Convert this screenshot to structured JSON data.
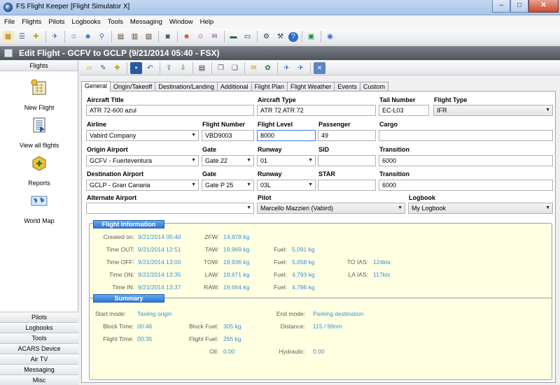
{
  "window": {
    "title": "FS Flight Keeper [Flight Simulator X]",
    "minimize": "–",
    "maximize": "□",
    "close": "✕"
  },
  "menu": [
    "File",
    "Flights",
    "Pilots",
    "Logbooks",
    "Tools",
    "Messaging",
    "Window",
    "Help"
  ],
  "header": {
    "title": "Edit Flight - GCFV to GCLP (9/21/2014 05:40 - FSX)"
  },
  "sidebar": {
    "heading": "Flights",
    "items": [
      {
        "label": "New Flight",
        "icon": "new-flight-icon"
      },
      {
        "label": "View all flights",
        "icon": "view-flights-icon"
      },
      {
        "label": "Reports",
        "icon": "reports-icon"
      },
      {
        "label": "World Map",
        "icon": "world-map-icon"
      }
    ],
    "sections": [
      "Pilots",
      "Logbooks",
      "Tools",
      "ACARS Device",
      "Air TV",
      "Messaging",
      "Misc"
    ]
  },
  "tabs": [
    "General",
    "Origin/Takeoff",
    "Destination/Landing",
    "Additional",
    "Flight Plan",
    "Flight Weather",
    "Events",
    "Custom"
  ],
  "form": {
    "aircraft_title_label": "Aircraft Title",
    "aircraft_title": "ATR 72-600 azul",
    "aircraft_type_label": "Aircraft Type",
    "aircraft_type": "ATR 72 ATR 72",
    "tail_number_label": "Tail Number",
    "tail_number": "EC-L03",
    "flight_type_label": "Flight Type",
    "flight_type": "IFR",
    "airline_label": "Airline",
    "airline": "Vabird Company",
    "flight_number_label": "Flight Number",
    "flight_number": "VBD9003",
    "flight_level_label": "Flight Level",
    "flight_level": "8000",
    "passenger_label": "Passenger",
    "passenger": "49",
    "cargo_label": "Cargo",
    "cargo": "",
    "origin_airport_label": "Origin Airport",
    "origin_airport": "GCFV - Fuerteventura",
    "origin_gate_label": "Gate",
    "origin_gate": "Gate 22",
    "origin_runway_label": "Runway",
    "origin_runway": "01",
    "sid_label": "SID",
    "sid": "",
    "origin_transition_label": "Transition",
    "origin_transition": "6000",
    "dest_airport_label": "Destination Airport",
    "dest_airport": "GCLP - Gran Canaria",
    "dest_gate_label": "Gate",
    "dest_gate": "Gate P 25",
    "dest_runway_label": "Runway",
    "dest_runway": "03L",
    "star_label": "STAR",
    "star": "",
    "dest_transition_label": "Transition",
    "dest_transition": "6000",
    "alternate_label": "Alternate Airport",
    "alternate": "",
    "pilot_label": "Pilot",
    "pilot": "Marcello Mazzieri (Vabird)",
    "logbook_label": "Logbook",
    "logbook": "My Logbook"
  },
  "flight_info": {
    "heading": "Flight Information",
    "created_on_label": "Created on:",
    "created_on": "9/21/2014 05:40",
    "time_out_label": "Time OUT:",
    "time_out": "9/21/2014 12:51",
    "time_off_label": "Time OFF:",
    "time_off": "9/21/2014 13:00",
    "time_on_label": "Time ON:",
    "time_on": "9/21/2014 13:35",
    "time_in_label": "Time IN:",
    "time_in": "9/21/2014 13:37",
    "zfw_label": "ZFW:",
    "zfw": "14,878 kg",
    "taw_label": "TAW:",
    "taw": "19,969 kg",
    "tow_label": "TOW:",
    "tow": "19,936 kg",
    "law_label": "LAW:",
    "law": "19,671 kg",
    "raw_label": "RAW:",
    "raw": "19,664 kg",
    "fuel_out_label": "Fuel:",
    "fuel_out": "5,091 kg",
    "fuel_off_label": "Fuel:",
    "fuel_off": "5,058 kg",
    "fuel_on_label": "Fuel:",
    "fuel_on": "4,793 kg",
    "fuel_in_label": "Fuel:",
    "fuel_in": "4,786 kg",
    "to_ias_label": "TO IAS:",
    "to_ias": "124kts",
    "la_ias_label": "LA IAS:",
    "la_ias": "117kts"
  },
  "summary": {
    "heading": "Summary",
    "start_mode_label": "Start mode:",
    "start_mode": "Taxiing origin",
    "end_mode_label": "End mode:",
    "end_mode": "Parking destination",
    "block_time_label": "Block Time:",
    "block_time": "00:46",
    "block_fuel_label": "Block Fuel:",
    "block_fuel": "305 kg",
    "distance_label": "Distance:",
    "distance": "115 / 99nm",
    "flight_time_label": "Flight Time:",
    "flight_time": "00:35",
    "flight_fuel_label": "Flight Fuel:",
    "flight_fuel": "265 kg",
    "oil_label": "Oil:",
    "oil": "0.00",
    "hydraulic_label": "Hydraulic:",
    "hydraulic": "0.00"
  },
  "colors": {
    "info_bg": "#ffffe1",
    "value_blue": "#3a8fd9",
    "group_tag": "#2f7ad6"
  }
}
